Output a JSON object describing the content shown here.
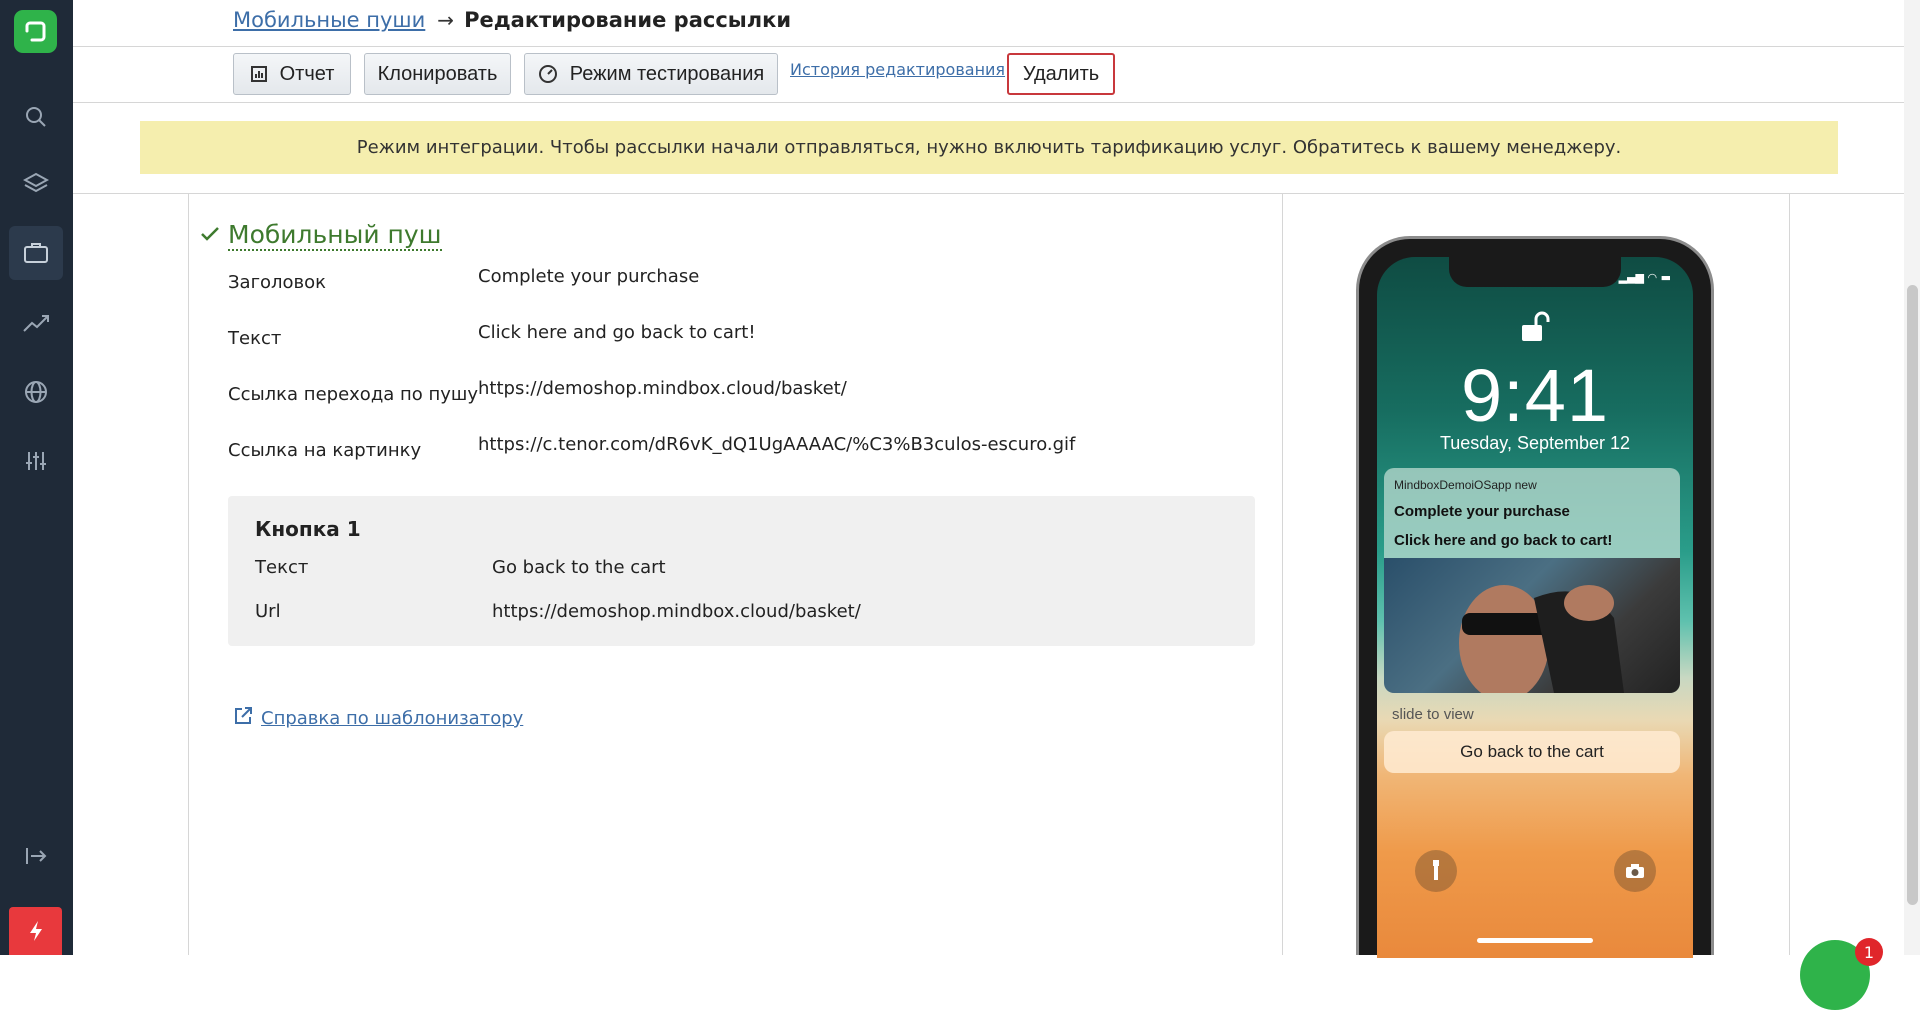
{
  "breadcrumb": {
    "parent": "Мобильные пуши",
    "current": "Редактирование рассылки"
  },
  "toolbar": {
    "report": "Отчет",
    "clone": "Клонировать",
    "test_mode": "Режим тестирования",
    "history": "История редактирования",
    "delete": "Удалить"
  },
  "banner": "Режим интеграции. Чтобы рассылки начали отправляться, нужно включить тарификацию услуг. Обратитесь к вашему менеджеру.",
  "section": {
    "title": "Мобильный пуш",
    "fields": [
      {
        "label": "Заголовок",
        "value": "Complete your purchase"
      },
      {
        "label": "Текст",
        "value": "Click here and go back to cart!"
      },
      {
        "label": "Ссылка перехода по пушу",
        "value": "https://demoshop.mindbox.cloud/basket/"
      },
      {
        "label": "Ссылка на картинку",
        "value": "https://c.tenor.com/dR6vK_dQ1UgAAAAC/%C3%B3culos-escuro.gif"
      }
    ],
    "button1": {
      "title": "Кнопка 1",
      "text_label": "Текст",
      "text_value": "Go back to the cart",
      "url_label": "Url",
      "url_value": "https://demoshop.mindbox.cloud/basket/"
    },
    "help_link": "Справка по шаблонизатору"
  },
  "preview": {
    "time": "9:41",
    "date": "Tuesday, September 12",
    "app_name": "MindboxDemoiOSapp new",
    "title": "Complete your purchase",
    "text": "Click here and go back to cart!",
    "slide_hint": "slide to view",
    "action": "Go back to the cart"
  },
  "chat_badge": "1",
  "colors": {
    "sidebar": "#1f2a38",
    "brand_green": "#2fb34a",
    "link": "#3d6ea8",
    "banner": "#f5eeae",
    "danger": "#c8383c"
  },
  "icons": [
    "logo-icon",
    "search-icon",
    "layers-icon",
    "briefcase-icon",
    "trend-icon",
    "globe-icon",
    "sliders-icon",
    "collapse-icon",
    "flash-icon",
    "report-icon",
    "speedometer-icon",
    "check-icon",
    "external-link-icon",
    "lock-icon",
    "flashlight-icon",
    "camera-icon"
  ]
}
